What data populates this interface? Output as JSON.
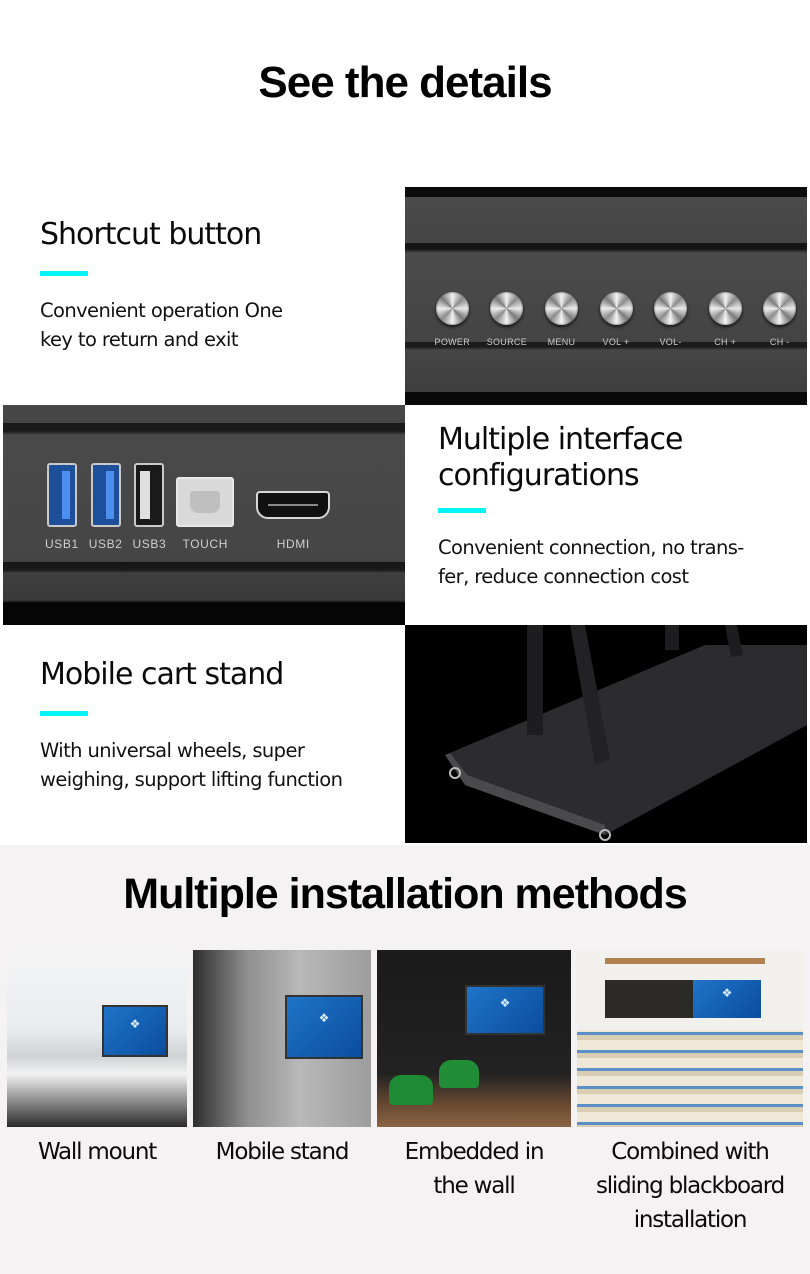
{
  "page": {
    "title_top": "See the details",
    "title_bottom": "Multiple installation methods"
  },
  "features": [
    {
      "heading": "Shortcut button",
      "description_lines": [
        "Convenient operation One",
        "key to return and exit"
      ]
    },
    {
      "heading_lines": [
        "Multiple interface",
        "configurations"
      ],
      "description_lines": [
        "Convenient connection, no trans-",
        "fer, reduce connection cost"
      ]
    },
    {
      "heading": "Mobile cart stand",
      "description_lines": [
        "With universal wheels, super",
        "weighing, support lifting function"
      ]
    }
  ],
  "accent_color": "#00f4f8",
  "button_panel": {
    "labels": [
      "POWER",
      "SOURCE",
      "MENU",
      "VOL +",
      "VOL-",
      "CH +",
      "CH -"
    ]
  },
  "port_panel": {
    "labels": [
      "USB1",
      "USB2",
      "USB3",
      "TOUCH",
      "HDMI"
    ]
  },
  "installation_methods": [
    {
      "label_lines": [
        "Wall mount"
      ]
    },
    {
      "label_lines": [
        "Mobile stand"
      ]
    },
    {
      "label_lines": [
        "Embedded in",
        "the wall"
      ]
    },
    {
      "label_lines": [
        "Combined with",
        "sliding blackboard",
        "installation"
      ]
    }
  ]
}
